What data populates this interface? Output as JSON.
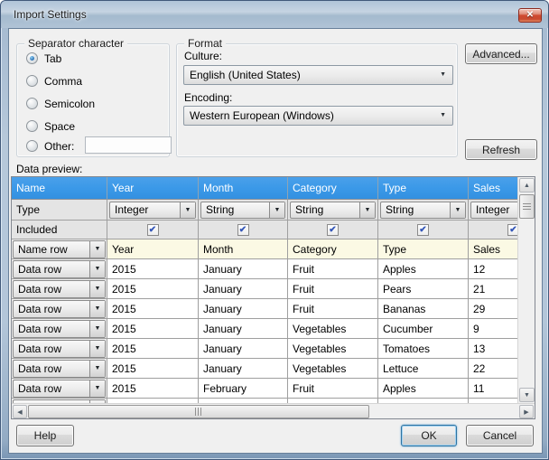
{
  "window": {
    "title": "Import Settings",
    "close_glyph": "✕"
  },
  "icons": {
    "dropdown": "▼",
    "up": "▲",
    "down": "▼",
    "left": "◀",
    "right": "▶",
    "check": "✔"
  },
  "separator": {
    "legend": "Separator character",
    "options": [
      {
        "label": "Tab",
        "selected": true
      },
      {
        "label": "Comma",
        "selected": false
      },
      {
        "label": "Semicolon",
        "selected": false
      },
      {
        "label": "Space",
        "selected": false
      },
      {
        "label": "Other:",
        "selected": false
      }
    ],
    "other_value": ""
  },
  "format": {
    "legend": "Format",
    "culture_label": "Culture:",
    "culture_value": "English (United States)",
    "encoding_label": "Encoding:",
    "encoding_value": "Western European (Windows)"
  },
  "buttons": {
    "advanced": "Advanced...",
    "refresh": "Refresh",
    "help": "Help",
    "ok": "OK",
    "cancel": "Cancel"
  },
  "preview": {
    "label": "Data preview:",
    "columns": [
      "Name",
      "Year",
      "Month",
      "Category",
      "Type",
      "Sales"
    ],
    "type_row": {
      "label": "Type",
      "values": [
        "Integer",
        "String",
        "String",
        "String",
        "Integer"
      ]
    },
    "included_row": {
      "label": "Included",
      "checked": [
        true,
        true,
        true,
        true,
        true
      ]
    },
    "rows": [
      {
        "kind": "name",
        "selector": "Name row",
        "values": [
          "Year",
          "Month",
          "Category",
          "Type",
          "Sales"
        ]
      },
      {
        "kind": "data",
        "selector": "Data row",
        "values": [
          "2015",
          "January",
          "Fruit",
          "Apples",
          "12"
        ]
      },
      {
        "kind": "data",
        "selector": "Data row",
        "values": [
          "2015",
          "January",
          "Fruit",
          "Pears",
          "21"
        ]
      },
      {
        "kind": "data",
        "selector": "Data row",
        "values": [
          "2015",
          "January",
          "Fruit",
          "Bananas",
          "29"
        ]
      },
      {
        "kind": "data",
        "selector": "Data row",
        "values": [
          "2015",
          "January",
          "Vegetables",
          "Cucumber",
          "9"
        ]
      },
      {
        "kind": "data",
        "selector": "Data row",
        "values": [
          "2015",
          "January",
          "Vegetables",
          "Tomatoes",
          "13"
        ]
      },
      {
        "kind": "data",
        "selector": "Data row",
        "values": [
          "2015",
          "January",
          "Vegetables",
          "Lettuce",
          "22"
        ]
      },
      {
        "kind": "data",
        "selector": "Data row",
        "values": [
          "2015",
          "February",
          "Fruit",
          "Apples",
          "11"
        ]
      },
      {
        "kind": "data",
        "selector": "Data row",
        "values": [
          "",
          "",
          "",
          "",
          ""
        ]
      }
    ]
  },
  "colors": {
    "grid_header_blue": "#3b99e8",
    "name_row_yellow": "#fbf9e4",
    "tool_row_gray": "#e4e4e4",
    "close_button_red": "#cf4a31",
    "frame_glass_blue": "#b6c8da"
  }
}
